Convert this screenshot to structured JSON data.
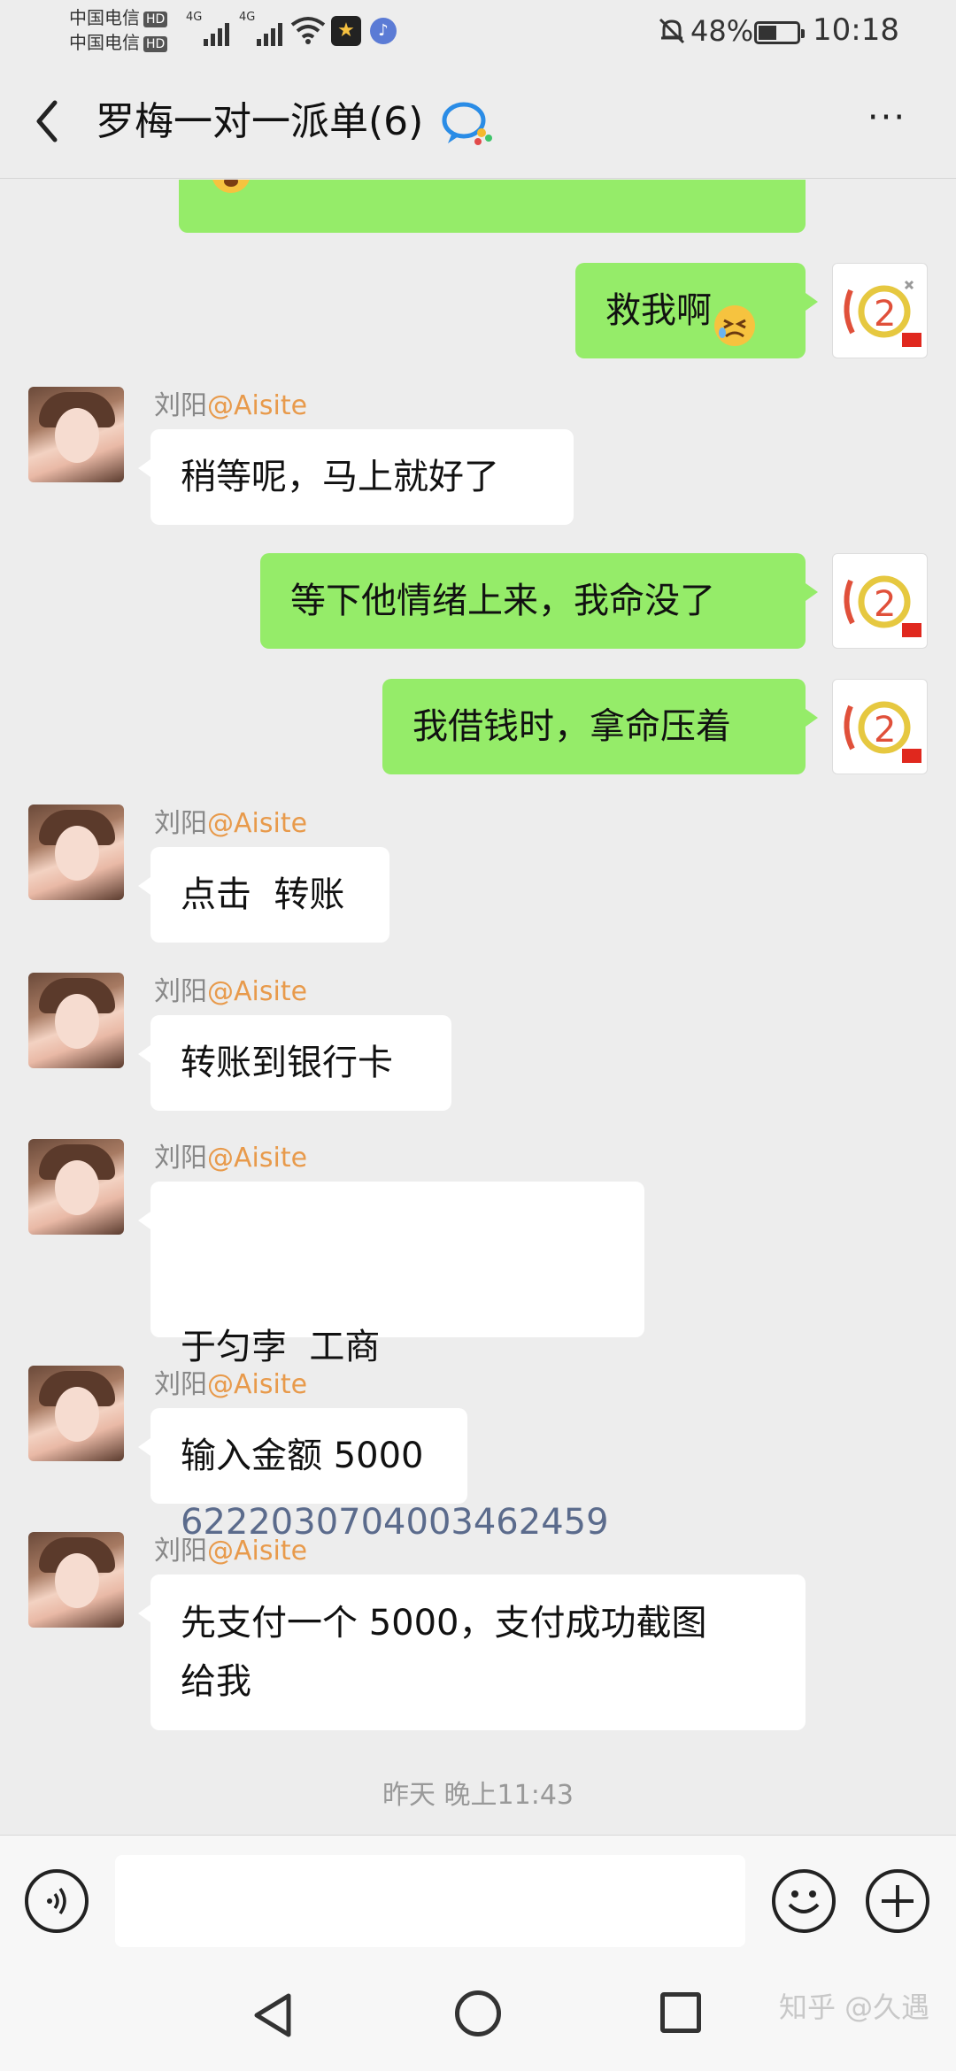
{
  "status_bar": {
    "carrier_1": "中国电信",
    "carrier_2": "中国电信",
    "hd": "HD",
    "network_1": "4G",
    "network_2": "4G",
    "battery_percent": "48%",
    "battery_level": 0.48,
    "time": "10:18"
  },
  "header": {
    "title": "罗梅一对一派单(6)",
    "more_label": "···"
  },
  "messages": [
    {
      "side": "right",
      "text": "救我啊"
    },
    {
      "side": "left",
      "sender": "刘阳",
      "mention": "@Aisite",
      "text": "稍等呢，马上就好了"
    },
    {
      "side": "right",
      "text": "等下他情绪上来，我命没了"
    },
    {
      "side": "right",
      "text": "我借钱时，拿命压着"
    },
    {
      "side": "left",
      "sender": "刘阳",
      "mention": "@Aisite",
      "text": "点击  转账"
    },
    {
      "side": "left",
      "sender": "刘阳",
      "mention": "@Aisite",
      "text": "转账到银行卡"
    },
    {
      "side": "left",
      "sender": "刘阳",
      "mention": "@Aisite",
      "text": "于匀孛  工商",
      "account": "6222030704003462459"
    },
    {
      "side": "left",
      "sender": "刘阳",
      "mention": "@Aisite",
      "text": "输入金额 5000"
    },
    {
      "side": "left",
      "sender": "刘阳",
      "mention": "@Aisite",
      "text_line1": "先支付一个 5000，支付成功截图",
      "text_line2": "给我"
    }
  ],
  "timestamp": "昨天 晚上11:43",
  "input": {
    "placeholder": ""
  },
  "watermark": "知乎 @久遇",
  "colors": {
    "background": "#ededed",
    "bubble_self": "#95ec69",
    "bubble_other": "#ffffff",
    "mention": "#e89a4b"
  }
}
